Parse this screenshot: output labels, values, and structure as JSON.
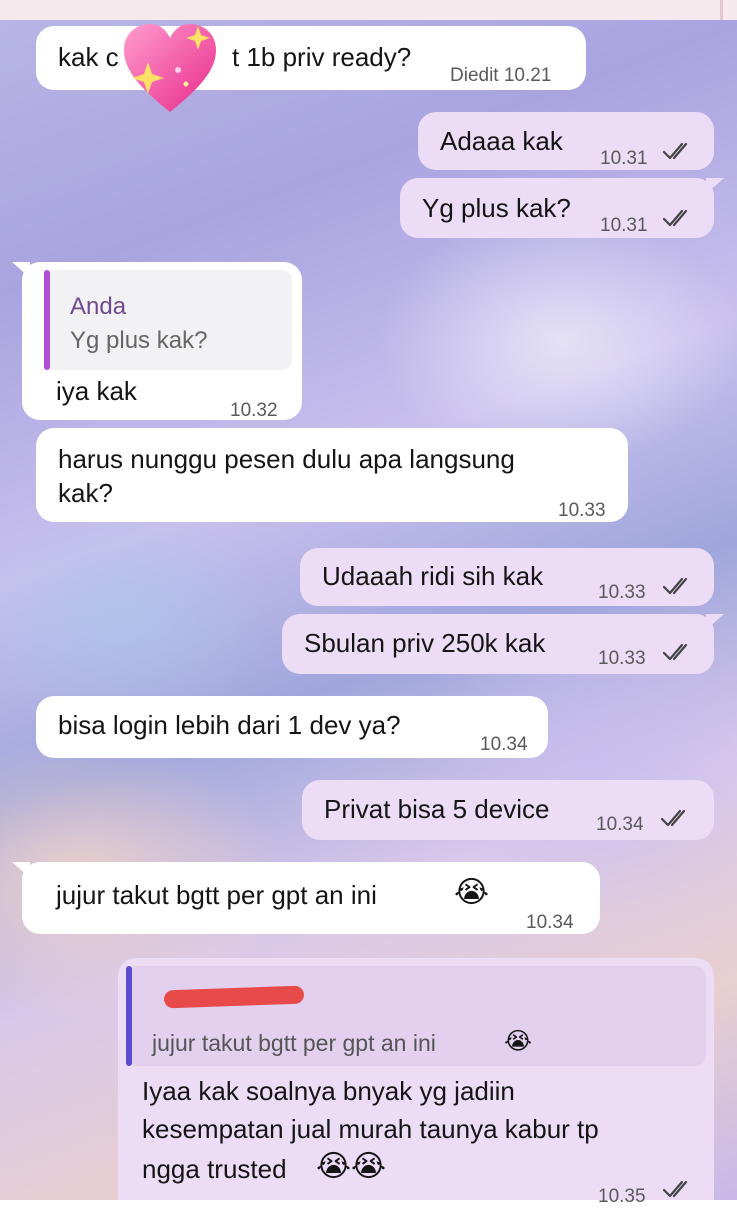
{
  "messages": {
    "m1": {
      "text_left": "kak c",
      "text_right": "t 1b priv ready?",
      "time": "Diedit 10.21"
    },
    "m2": {
      "text": "Adaaa kak",
      "time": "10.31"
    },
    "m3": {
      "text": "Yg plus kak?",
      "time": "10.31"
    },
    "m4": {
      "quote_author": "Anda",
      "quote_text": "Yg plus kak?",
      "text": "iya kak",
      "time": "10.32"
    },
    "m5": {
      "line1": "harus nunggu pesen dulu apa langsung",
      "line2": "kak?",
      "time": "10.33"
    },
    "m6": {
      "text": "Udaaah ridi sih kak",
      "time": "10.33"
    },
    "m7": {
      "text": "Sbulan priv 250k kak",
      "time": "10.33"
    },
    "m8": {
      "text": "bisa login lebih dari 1 dev ya?",
      "time": "10.34"
    },
    "m9": {
      "text": "Privat bisa 5 device",
      "time": "10.34"
    },
    "m10": {
      "text": "jujur takut bgtt per gpt an ini",
      "emoji": "😭",
      "time": "10.34"
    },
    "m11": {
      "quote_text": "jujur takut bgtt per gpt an ini",
      "quote_emoji": "😭",
      "line1": "Iyaa kak soalnya bnyak yg jadiin",
      "line2": "kesempatan jual murah taunya kabur tp",
      "line3": "ngga trusted",
      "emoji": "😭😭",
      "time": "10.35"
    }
  },
  "icons": {
    "sticker": "sparkling-heart-icon",
    "read_receipt": "double-check-icon"
  },
  "colors": {
    "incoming_bubble": "#ffffff",
    "outgoing_bubble": "#eddcf6",
    "quote_bar_purple": "#b04fd6",
    "quote_bar_indigo": "#5b4fd0",
    "redaction": "#e84a4a"
  }
}
